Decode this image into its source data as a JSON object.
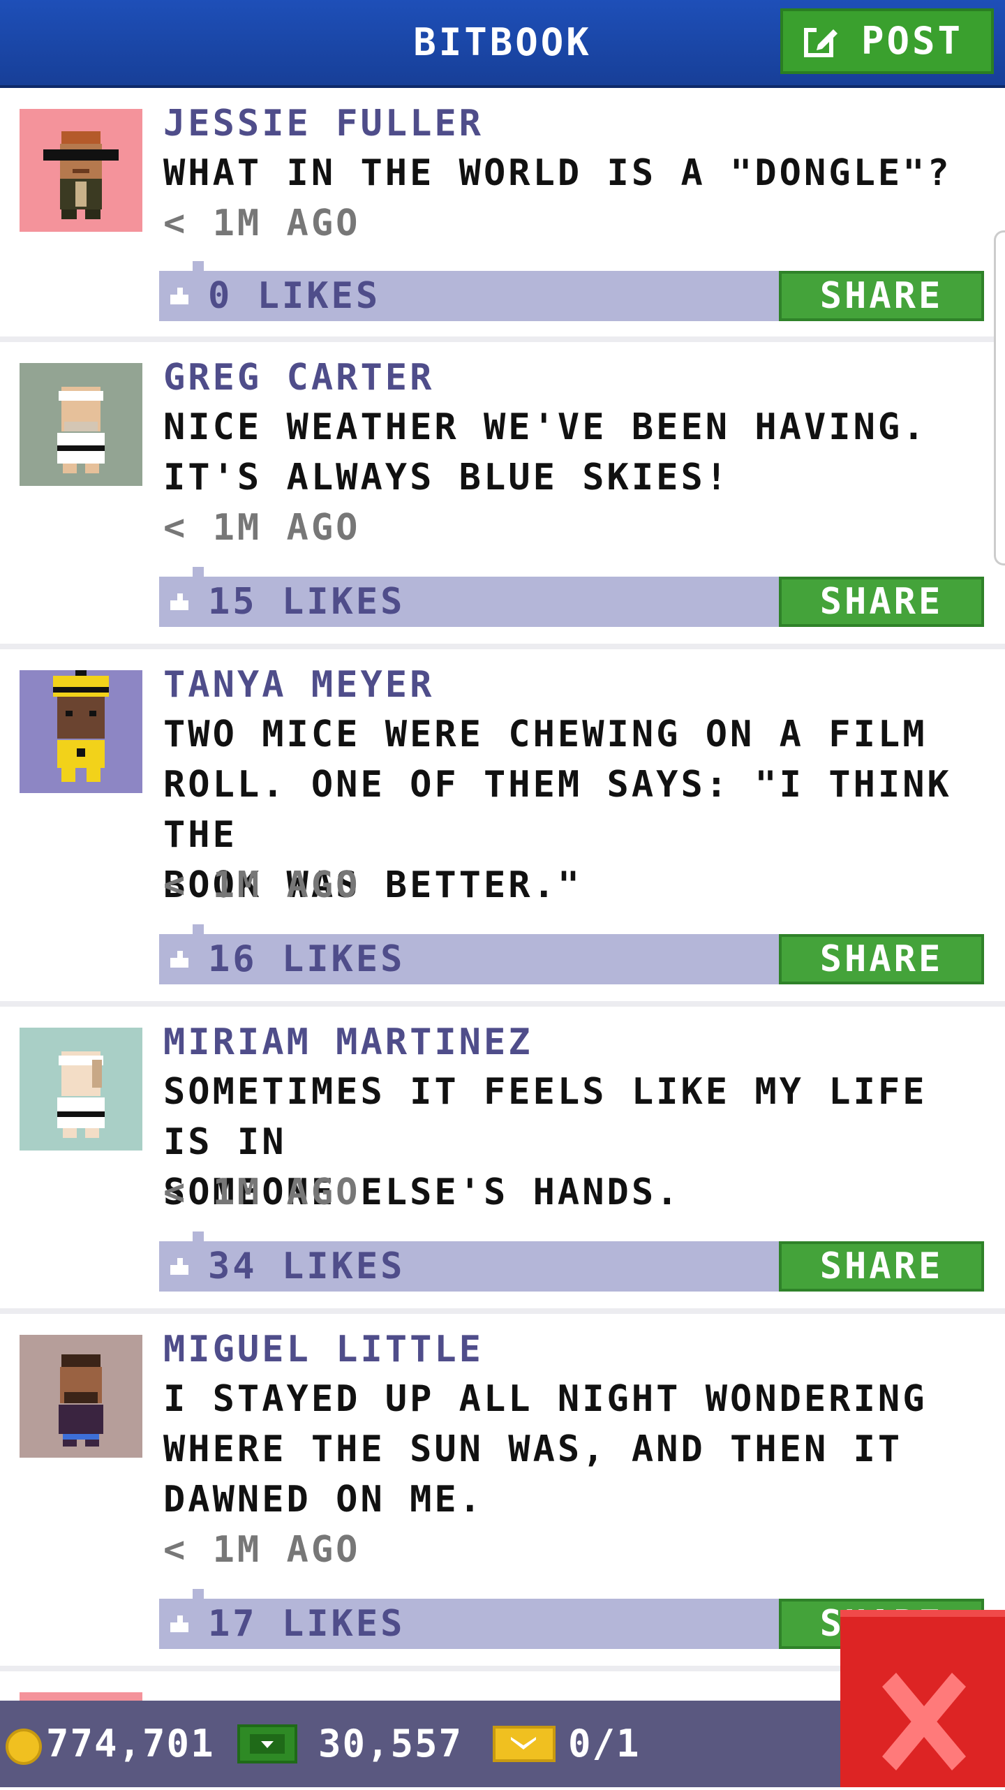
{
  "header": {
    "title": "BITBOOK",
    "post_label": "POST"
  },
  "posts": [
    {
      "author": "JESSIE FULLER",
      "text": "WHAT IN THE WORLD IS A \"DONGLE\"?",
      "time": "< 1M AGO",
      "likes": "0 LIKES",
      "share": "SHARE",
      "avatar_bg": "#f4939b"
    },
    {
      "author": "GREG CARTER",
      "text": "NICE WEATHER WE'VE BEEN HAVING.\nIT'S ALWAYS BLUE SKIES!",
      "time": "< 1M AGO",
      "likes": "15 LIKES",
      "share": "SHARE",
      "avatar_bg": "#93a493"
    },
    {
      "author": "TANYA MEYER",
      "text": "TWO MICE WERE CHEWING ON A FILM\nROLL. ONE OF THEM SAYS: \"I THINK THE\nBOOK WAS BETTER.\"",
      "time": "< 1M AGO",
      "likes": "16 LIKES",
      "share": "SHARE",
      "avatar_bg": "#8d86c4"
    },
    {
      "author": "MIRIAM MARTINEZ",
      "text": "SOMETIMES IT FEELS LIKE MY LIFE IS IN\nSOMEONE ELSE'S HANDS.",
      "time": "< 1M AGO",
      "likes": "34 LIKES",
      "share": "SHARE",
      "avatar_bg": "#a9cfc6"
    },
    {
      "author": "MIGUEL LITTLE",
      "text": "I STAYED UP ALL NIGHT WONDERING\nWHERE THE SUN WAS, AND THEN IT\nDAWNED ON ME.",
      "time": "< 1M AGO",
      "likes": "17 LIKES",
      "share": "SHARE",
      "avatar_bg": "#b69e9a"
    }
  ],
  "footer": {
    "coins": "774,701",
    "bux": "30,557",
    "tickets": "0/1"
  },
  "colors": {
    "header": "#1e4fb8",
    "post_green": "#3aa02e",
    "like_bar": "#b4b6d8",
    "author": "#4f4d8a",
    "footer": "#5a5880",
    "close_red": "#dd2424"
  },
  "icons": [
    "edit-icon",
    "thumbs-up-icon",
    "coin-icon",
    "bux-icon",
    "ticket-icon",
    "close-icon"
  ]
}
